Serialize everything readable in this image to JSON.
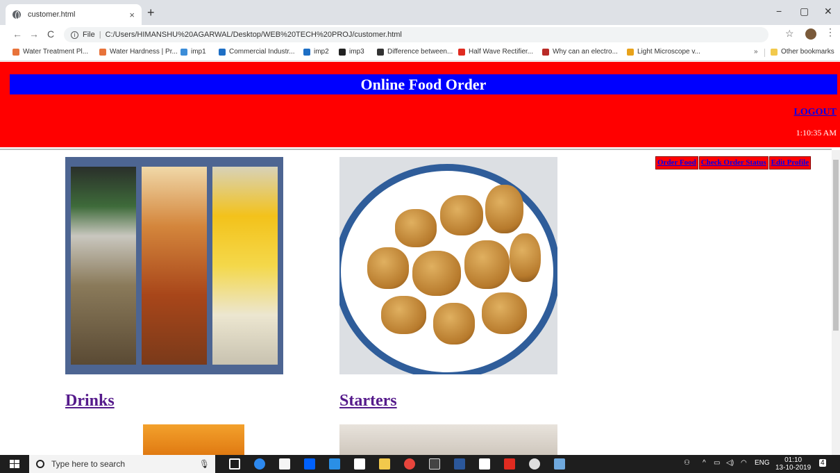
{
  "browser": {
    "tab_title": "customer.html",
    "tab_close": "×",
    "new_tab": "+",
    "min": "−",
    "max": "▢",
    "close": "✕",
    "back": "←",
    "forward": "→",
    "reload": "C",
    "protocol": "File",
    "url": "C:/Users/HIMANSHU%20AGARWAL/Desktop/WEB%20TECH%20PROJ/customer.html",
    "more": "⋮",
    "star": "☆"
  },
  "bookmarks": {
    "items": [
      {
        "label": "Water Treatment Pl...",
        "color": "#e8733a"
      },
      {
        "label": "Water Hardness | Pr...",
        "color": "#e8733a"
      },
      {
        "label": "imp1",
        "color": "#3c8dd8"
      },
      {
        "label": "Commercial Industr...",
        "color": "#1e6fc5"
      },
      {
        "label": "imp2",
        "color": "#1e6fc5"
      },
      {
        "label": "imp3",
        "color": "#222222"
      },
      {
        "label": "Difference between...",
        "color": "#333333"
      },
      {
        "label": "Half Wave Rectifier...",
        "color": "#e02b20"
      },
      {
        "label": "Why can an electro...",
        "color": "#b92b27"
      },
      {
        "label": "Light Microscope v...",
        "color": "#e8a21a"
      }
    ],
    "overflow": "»",
    "other": "Other bookmarks"
  },
  "page": {
    "title": "Online Food Order",
    "logout": "LOGOUT",
    "clock": "1:10:35 AM",
    "nav": [
      "Order Food",
      "Check Order Status",
      "Edit Profile"
    ],
    "categories": [
      "Drinks",
      "Starters"
    ]
  },
  "taskbar": {
    "search_placeholder": "Type here to search",
    "lang": "ENG",
    "time": "01:10",
    "date": "13-10-2019",
    "notif_count": "4"
  },
  "colors": {
    "header_bg": "#ff0000",
    "title_bg": "#0000ff",
    "link": "#0000ee",
    "visited": "#551a8b"
  }
}
